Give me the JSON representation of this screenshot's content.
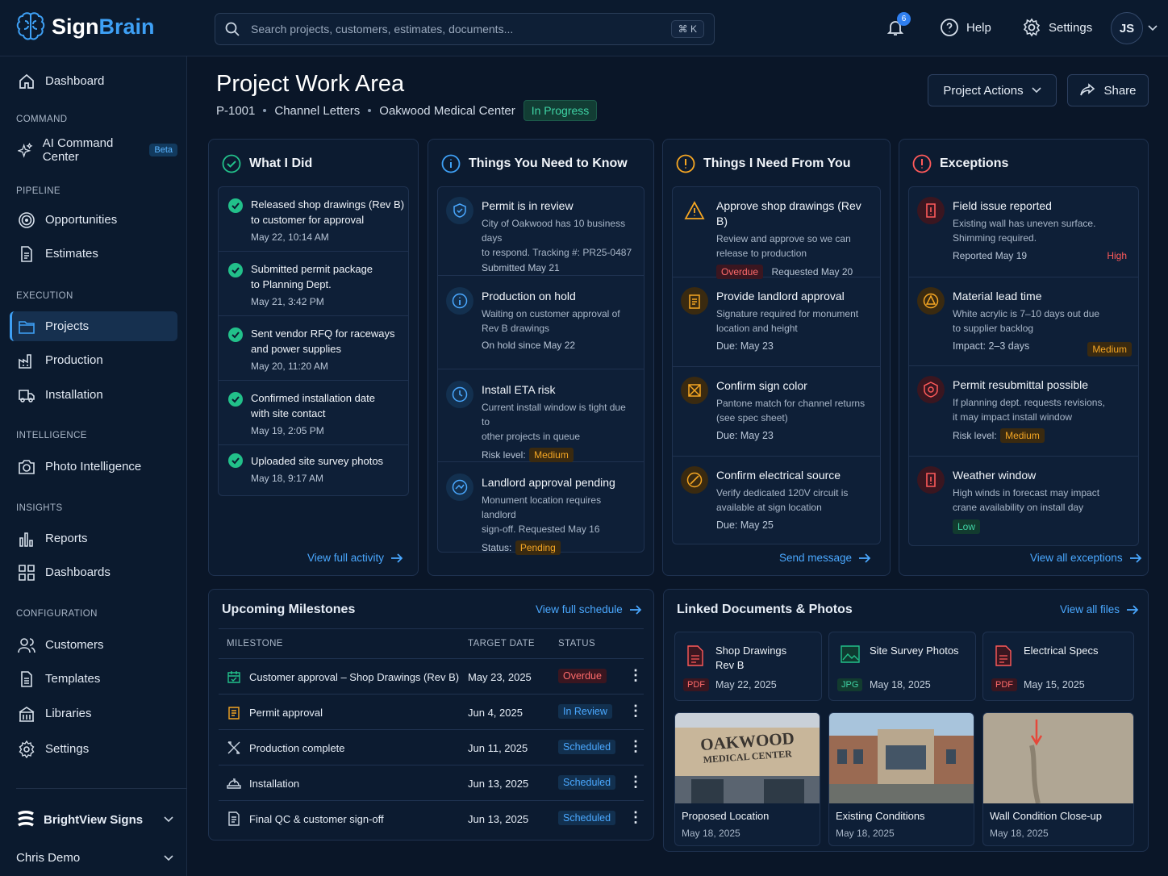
{
  "app": {
    "name_a": "Sign",
    "name_b": "Brain"
  },
  "search": {
    "placeholder": "Search projects, customers, estimates, documents...",
    "shortcut": "⌘ K"
  },
  "topbar": {
    "notifications": "6",
    "help": "Help",
    "settings": "Settings",
    "avatar": "JS"
  },
  "sidebar": {
    "dashboard": "Dashboard",
    "sec_command": "COMMAND",
    "ai": "AI Command Center",
    "beta": "Beta",
    "sec_pipeline": "PIPELINE",
    "opportunities": "Opportunities",
    "estimates": "Estimates",
    "sec_execution": "EXECUTION",
    "projects": "Projects",
    "production": "Production",
    "installation": "Installation",
    "sec_intel": "INTELLIGENCE",
    "photo": "Photo Intelligence",
    "sec_insights": "INSIGHTS",
    "reports": "Reports",
    "dashboards": "Dashboards",
    "sec_config": "CONFIGURATION",
    "customers": "Customers",
    "templates": "Templates",
    "libraries": "Libraries",
    "settings": "Settings",
    "org": "BrightView Signs",
    "user": "Chris Demo"
  },
  "page": {
    "title": "Project Work Area",
    "id": "P-1001",
    "type": "Channel Letters",
    "customer": "Oakwood Medical Center",
    "status": "In Progress",
    "actions": "Project Actions",
    "share": "Share"
  },
  "did": {
    "title": "What I Did",
    "link": "View full activity",
    "items": [
      {
        "t1": "Released shop drawings (Rev B)",
        "t2": "to customer for approval",
        "d": "May 22, 10:14 AM"
      },
      {
        "t1": "Submitted permit package",
        "t2": "to Planning Dept.",
        "d": "May 21, 3:42 PM"
      },
      {
        "t1": "Sent vendor RFQ for raceways",
        "t2": "and power supplies",
        "d": "May 20, 11:20 AM"
      },
      {
        "t1": "Confirmed installation date",
        "t2": "with site contact",
        "d": "May 19, 2:05 PM"
      },
      {
        "t1": "Uploaded site survey photos",
        "t2": "",
        "d": "May 18, 9:17 AM"
      }
    ]
  },
  "know": {
    "title": "Things You Need to Know",
    "items": [
      {
        "t": "Permit is in review",
        "d1": "City of Oakwood has 10 business days",
        "d2": "to respond. Tracking #: PR25-0487",
        "m": "Submitted May 21"
      },
      {
        "t": "Production on hold",
        "d1": "Waiting on customer approval of",
        "d2": "Rev B drawings",
        "m": "On hold since May 22"
      },
      {
        "t": "Install ETA risk",
        "d1": "Current install window is tight due to",
        "d2": "other projects in queue",
        "m": "Risk level:",
        "p": "Medium"
      },
      {
        "t": "Landlord approval pending",
        "d1": "Monument location requires landlord",
        "d2": "sign-off. Requested May 16",
        "m": "Status:",
        "p": "Pending"
      }
    ]
  },
  "need": {
    "title": "Things I Need From You",
    "link": "Send message",
    "items": [
      {
        "t": "Approve shop drawings (Rev B)",
        "d1": "Review and approve so we can",
        "d2": "release to production",
        "p": "Overdue",
        "m": "Requested May 20"
      },
      {
        "t": "Provide landlord approval",
        "d1": "Signature required for monument",
        "d2": "location and height",
        "m": "Due: May 23"
      },
      {
        "t": "Confirm sign color",
        "d1": "Pantone match for channel returns",
        "d2": "(see spec sheet)",
        "m": "Due: May 23"
      },
      {
        "t": "Confirm electrical source",
        "d1": "Verify dedicated 120V circuit is",
        "d2": "available at sign location",
        "m": "Due: May 25"
      }
    ]
  },
  "exc": {
    "title": "Exceptions",
    "link": "View all exceptions",
    "items": [
      {
        "t": "Field issue reported",
        "d1": "Existing wall has uneven surface.",
        "d2": "Shimming required.",
        "m": "Reported May 19",
        "p": "High"
      },
      {
        "t": "Material lead time",
        "d1": "White acrylic is 7–10 days out due",
        "d2": "to supplier backlog",
        "m": "Impact: 2–3 days",
        "p": "Medium"
      },
      {
        "t": "Permit resubmittal possible",
        "d1": "If planning dept. requests revisions,",
        "d2": "it may impact install window",
        "m": "Risk level:",
        "p": "Medium"
      },
      {
        "t": "Weather window",
        "d1": "High winds in forecast may impact",
        "d2": "crane availability on install day",
        "p": "Low"
      }
    ]
  },
  "milestones": {
    "title": "Upcoming Milestones",
    "link": "View full schedule",
    "h1": "MILESTONE",
    "h2": "TARGET DATE",
    "h3": "STATUS",
    "rows": [
      {
        "n": "Customer approval – Shop Drawings (Rev B)",
        "d": "May 23, 2025",
        "s": "Overdue"
      },
      {
        "n": "Permit approval",
        "d": "Jun 4, 2025",
        "s": "In Review"
      },
      {
        "n": "Production complete",
        "d": "Jun 11, 2025",
        "s": "Scheduled"
      },
      {
        "n": "Installation",
        "d": "Jun 13, 2025",
        "s": "Scheduled"
      },
      {
        "n": "Final QC & customer sign-off",
        "d": "Jun 13, 2025",
        "s": "Scheduled"
      }
    ]
  },
  "docs": {
    "title": "Linked Documents & Photos",
    "link": "View all files",
    "files": [
      {
        "n1": "Shop Drawings",
        "n2": "Rev B",
        "t": "PDF",
        "d": "May 22, 2025"
      },
      {
        "n1": "Site Survey Photos",
        "n2": "",
        "t": "JPG",
        "d": "May 18, 2025"
      },
      {
        "n1": "Electrical Specs",
        "n2": "",
        "t": "PDF",
        "d": "May 15, 2025"
      }
    ],
    "photos": [
      {
        "n": "Proposed Location",
        "d": "May 18, 2025",
        "sign1": "OAKWOOD",
        "sign2": "MEDICAL CENTER"
      },
      {
        "n": "Existing Conditions",
        "d": "May 18, 2025"
      },
      {
        "n": "Wall Condition Close-up",
        "d": "May 18, 2025"
      }
    ]
  },
  "colors": {
    "accent": "#3ea0f5",
    "green": "#22c08a",
    "orange": "#f5a623",
    "red": "#ff5a5a",
    "bg": "#0a1628"
  }
}
